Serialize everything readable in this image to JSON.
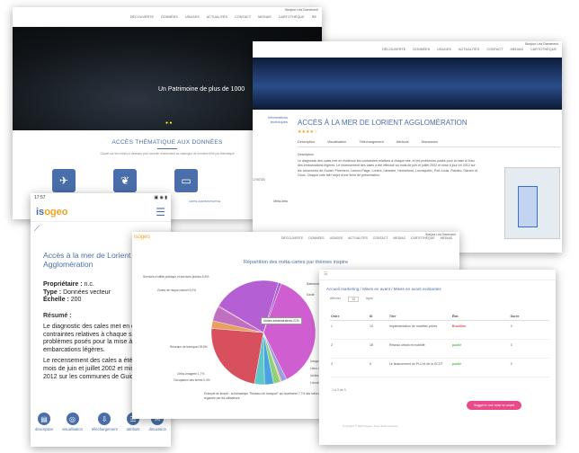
{
  "shot1": {
    "topbar": "Bonjour Léa Domenech",
    "nav": [
      "DÉCOUVERTE",
      "DONNÉES",
      "USAGES",
      "ACTUALITÉS",
      "CONTACT",
      "MEDIAS",
      "CARTOTHÈQUE",
      "RE"
    ],
    "hero_text": "Un Patrimoine de plus de 1000",
    "dots": "● ●",
    "section_title": "ACCÈS THÉMATIQUE AUX DONNÉES",
    "section_sub": "Cliquer sur les icônes ci-dessous pour accéder directement au catalogue de données filtré par thématique",
    "tile_label": "LIMITE ADMINISTRATIVE"
  },
  "shot2": {
    "topbar": "Bonjour Léa Domenech",
    "nav": [
      "DÉCOUVERTE",
      "DONNÉES",
      "USAGES",
      "ACTUALITÉS",
      "CONTACT",
      "MEDIAS",
      "CARTOTHÈQUE"
    ],
    "side_title": "Informations techniques",
    "side_date": "17/07/20",
    "side_meta": "Méta-déta",
    "title": "ACCÈS À LA MER DE LORIENT AGGLOMÉRATION",
    "stars": "★★★★☆",
    "tabs": [
      "Description",
      "Visualisation",
      "Téléchargement",
      "Attributs",
      "Discussion"
    ],
    "desc_head": "Description",
    "desc": "Le diagnostic des cales met en évidence les contraintes relatives à chaque site, et les problèmes posés pour la mise à l'eau des embarcations légères. Le recensement des cales a été effectué au mois de juin et juillet 2002 et mise à jour en 2012 sur les communes de Guidel, Ploemeur, Larmor-Plage, Lorient, Lanester, Hennebont, Locmiquélic, Port-Louis, Riantec, Gâvres et Groix. Chaque cale fait l'objet d'une fiche de présentation."
  },
  "shot3": {
    "status_time": "17:57",
    "status_icons": "▣ ◉ ▮",
    "logo_is": "is",
    "logo_geo": "ogeo",
    "title": "Accès à la mer de Lorient Agglomération",
    "owner_label": "Propriétaire :",
    "owner_value": "n.c.",
    "type_label": "Type :",
    "type_value": "Données vecteur",
    "scale_label": "Échelle :",
    "scale_value": "200",
    "summary_label": "Résumé :",
    "summary": "Le diagnostic des cales met en évidence les contraintes relatives à chaque site, et les problèmes posés pour la mise à l'eau des embarcations légères.",
    "summary2": "Le recensement des cales a été effectué au mois de juin et juillet 2002 et mise à jour en 2012 sur les communes de Guidel, Ploemeur",
    "bottom": [
      {
        "icon": "description-icon",
        "glyph": "▤",
        "label": "description"
      },
      {
        "icon": "visualisation-icon",
        "glyph": "◎",
        "label": "visualisation"
      },
      {
        "icon": "telechargement-icon",
        "glyph": "⇩",
        "label": "téléchargement"
      },
      {
        "icon": "attributs-icon",
        "glyph": "☰",
        "label": "attributs"
      },
      {
        "icon": "discussion-icon",
        "glyph": "✉",
        "label": "discussion"
      }
    ]
  },
  "shot4": {
    "logo": "isogeo",
    "topbar": "Bonjour Léa Domenech",
    "nav": [
      "DÉCOUVERTE",
      "DONNÉES",
      "USAGES",
      "ACTUALITÉS",
      "CONTACT",
      "MEDIAS",
      "CARTOTHÈQUE",
      "MEDIAS"
    ],
    "footnote": "Exemple de lecture : la thématique \"Réseaux de transport\" qui représente 7,7% des méta-cartes est la plus utilisée. Cette donnée est la plus regardée par les utilisateurs."
  },
  "chart_data": {
    "type": "pie",
    "title": "Répartition des méta-cartes par thèmes inspire",
    "slices": [
      {
        "label": "Zones de risque naturel",
        "value": 37.1,
        "color": "#cf5fd0"
      },
      {
        "label": "Ortho-imagerie",
        "value": 1.7,
        "color": "#9aa0e0"
      },
      {
        "label": "Occupation des terres",
        "value": 0.4,
        "color": "#f0c040"
      },
      {
        "label": "Usage des sols",
        "value": 2.1,
        "color": "#8fd07a"
      },
      {
        "label": "Lieux de stationnement",
        "value": 2.8,
        "color": "#4aa3df"
      },
      {
        "label": "L'environnement",
        "value": 3.1,
        "color": "#5ec7c7"
      },
      {
        "label": "Unités administratives",
        "value": 23.5,
        "color": "#d8505e"
      },
      {
        "label": "Santé",
        "value": 2.4,
        "color": "#e7a060"
      },
      {
        "label": "Bâtiments",
        "value": 4.6,
        "color": "#c070c0"
      },
      {
        "label": "Sites protégés",
        "value": 0.3,
        "color": "#d060a0"
      },
      {
        "label": "Zones à réglementation",
        "value": 21.1,
        "color": "#b55fd5"
      },
      {
        "label": "Réseaux de transport",
        "value": 0.9,
        "color": "#a860d0"
      }
    ],
    "labels_left": [
      "Services d'utilité publique et services publics 5,5%",
      "Zones de risque naturel 9,0%",
      "Réseaux de transport 25,8%",
      "Ortho-imagerie 1,7%",
      "Occupation des terres 0,4%"
    ],
    "labels_right": [
      "Bâtiments 4,6%",
      "Santé",
      "Usage des sols",
      "Lieux de statio",
      "Unités",
      "L'enviro"
    ],
    "tooltip": "Unités administratives 21%"
  },
  "shot5": {
    "topbar": "☰",
    "breadcrumb": "Accueil marketing / Mises en avant / Mises en avant existantes",
    "controls": [
      "Afficher",
      "10",
      "ligne"
    ],
    "columns": [
      "Ordre",
      "ID",
      "Titre",
      "État",
      "Durée"
    ],
    "rows": [
      {
        "ordre": "1",
        "id": "13",
        "titre": "Implémentation de modèles privés",
        "etat": "Brouillon",
        "duree": "3"
      },
      {
        "ordre": "2",
        "id": "18",
        "titre": "Réseau urbain et mobilité",
        "etat": "publié",
        "duree": "3"
      },
      {
        "ordre": "3",
        "id": "6",
        "titre": "Le financement du PLU et de la SCOT",
        "etat": "publié",
        "duree": "3"
      }
    ],
    "pager": "1 à 3 de 3",
    "button": "Suggérer une mise en avant",
    "footer": "Copyright © 2020 Isogeo. Tous droits réservés"
  }
}
